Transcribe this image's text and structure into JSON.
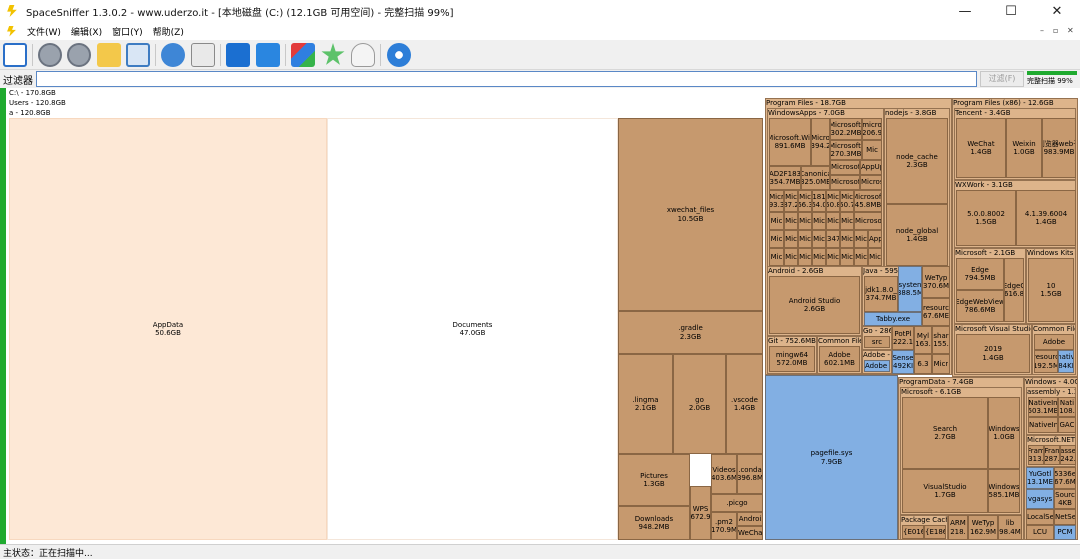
{
  "window": {
    "title": "SpaceSniffer 1.3.0.2 - www.uderzo.it - [本地磁盘 (C:) (12.1GB 可用空间) - 完整扫描 99%]",
    "minimize": "—",
    "maximize": "☐",
    "close": "✕"
  },
  "menu": {
    "items": [
      "文件(W)",
      "编辑(X)",
      "窗口(Y)",
      "帮助(Z)"
    ],
    "mdi": [
      "–",
      "▫",
      "✕"
    ]
  },
  "toolbar": {
    "icons": [
      "new-scan-icon",
      "back-icon",
      "forward-icon",
      "folder-up-icon",
      "home-icon",
      "refresh-icon",
      "export-icon",
      "blue-cube-icon",
      "blue-cube-2-icon",
      "blocks-icon",
      "star-icon",
      "ghost-icon",
      "settings-gear-icon"
    ]
  },
  "filter": {
    "label": "过滤器",
    "value": "",
    "button": "过滤(F)",
    "progress_text": "完整扫描 99%",
    "progress": 0.99
  },
  "treemap": {
    "root": "C:\\ - 170.8GB",
    "users": "Users - 120.8GB",
    "user_a": "a - 120.8GB",
    "appdata": {
      "name": "AppData",
      "size": "50.6GB"
    },
    "documents": {
      "name": "Documents",
      "size": "47.0GB"
    },
    "xwechat_files": {
      "name": "xwechat_files",
      "size": "10.5GB"
    },
    "gradle": {
      "name": ".gradle",
      "size": "2.3GB"
    },
    "lingma": {
      "name": ".lingma",
      "size": "2.1GB"
    },
    "go": {
      "name": "go",
      "size": "2.0GB"
    },
    "vscode": {
      "name": ".vscode",
      "size": "1.4GB"
    },
    "pictures": {
      "name": "Pictures",
      "size": "1.3GB"
    },
    "videos": {
      "name": "Videos",
      "size": "403.6M"
    },
    "conda": {
      "name": ".conda",
      "size": "396.8M"
    },
    "wps": {
      "name": "WPS",
      "size": "672.9"
    },
    "picgo": {
      "name": ".picgo",
      "size": ""
    },
    "downloads": {
      "name": "Downloads",
      "size": "948.2MB"
    },
    "pm2": {
      "name": ".pm2",
      "size": "170.9M"
    },
    "android_small": {
      "name": "Androi",
      "size": ""
    },
    "wechat_small": {
      "name": "WeCha",
      "size": ""
    },
    "program_files": "Program Files - 18.7GB",
    "windowsapps": "WindowsApps - 7.0GB",
    "ms_win": {
      "name": "Microsoft.Wir",
      "size": "891.6MB"
    },
    "ms_394": {
      "name": "Micro",
      "size": "394.2"
    },
    "ms_302": {
      "name": "Microsoft.",
      "size": "302.2MB"
    },
    "micro_206": {
      "name": "micro",
      "size": "206.9"
    },
    "ms_270": {
      "name": "Microsoft.",
      "size": "270.3MB"
    },
    "ad2f": {
      "name": "AD2F183",
      "size": "354.7MB"
    },
    "canonical": {
      "name": "Canonica",
      "size": "325.0MB"
    },
    "microsoft_s": "Microsoft",
    "appup": "AppUp",
    "micros": "Micros",
    "mic93": {
      "name": "Micr",
      "size": "93.3"
    },
    "mic87": {
      "name": "Mic",
      "size": "87.2"
    },
    "mic66": {
      "name": "Mic",
      "size": "66.3"
    },
    "m181": {
      "name": "181",
      "size": "64.0"
    },
    "mic50": {
      "name": "Mic",
      "size": "50.8"
    },
    "mic507": {
      "name": "Mic",
      "size": "50.7"
    },
    "ms45": {
      "name": "Microsoft",
      "size": "45.8MB"
    },
    "mic_grid": "Mic",
    "m347": "347",
    "app_s": "App",
    "nodejs": "nodejs - 3.8GB",
    "node_cache": {
      "name": "node_cache",
      "size": "2.3GB"
    },
    "node_global": {
      "name": "node_global",
      "size": "1.4GB"
    },
    "android_pf": "Android - 2.6GB",
    "android_studio": {
      "name": "Android Studio",
      "size": "2.6GB"
    },
    "java": "Java - 595",
    "jdk": {
      "name": "jdk1.8.0_",
      "size": "374.7MB"
    },
    "systen": {
      "name": "systen",
      "size": "388.5M"
    },
    "tabby": "Tabby.exe",
    "wetyp": {
      "name": "WeTyp",
      "size": "370.6M"
    },
    "resourc": {
      "name": "resourc",
      "size": "67.6ME"
    },
    "git": "Git - 752.6MB",
    "mingw": {
      "name": "mingw64",
      "size": "572.0MB"
    },
    "common_files": "Common File",
    "adobe_pf": {
      "name": "Adobe",
      "size": "602.1MB"
    },
    "go_pf": "Go - 286",
    "src": "src",
    "potpl": {
      "name": "PotPl",
      "size": "222.1"
    },
    "myl": {
      "name": "Myl",
      "size": "163."
    },
    "shar": {
      "name": "shar",
      "size": "155."
    },
    "adobe_dash": "Adobe -",
    "adobe_small": "Adobe (",
    "sense": {
      "name": "Sense",
      "size": "492KI"
    },
    "s63": "6.3",
    "micr_s": "Micr",
    "pagefile": {
      "name": "pagefile.sys",
      "size": "7.9GB"
    },
    "program_files_x86": "Program Files (x86) - 12.6GB",
    "tencent": "Tencent - 3.4GB",
    "wechat": {
      "name": "WeChat",
      "size": "1.4GB"
    },
    "weixin": {
      "name": "Weixin",
      "size": "1.0GB"
    },
    "qq_web": {
      "name": "浏览器web子",
      "size": "983.9MB"
    },
    "wxwork": "WXWork - 3.1GB",
    "v5": {
      "name": "5.0.0.8002",
      "size": "1.5GB"
    },
    "v41": {
      "name": "4.1.39.6004",
      "size": "1.4GB"
    },
    "microsoft_x86": "Microsoft - 2.1GB",
    "windows_kits": "Windows Kits -",
    "edge": {
      "name": "Edge",
      "size": "794.5MB"
    },
    "edgec": {
      "name": "EdgeC",
      "size": "616.8"
    },
    "edgewebview": {
      "name": "EdgeWebView",
      "size": "786.6MB"
    },
    "ten": {
      "name": "10",
      "size": "1.5GB"
    },
    "ms_visual_studio": "Microsoft Visual Studio -",
    "y2019": {
      "name": "2019",
      "size": "1.4GB"
    },
    "common_files_x86": "Common File",
    "adobe_x86": "Adobe",
    "resourc2": {
      "name": "resourc",
      "size": "192.5M"
    },
    "nativ": {
      "name": "nativ",
      "size": "84KI"
    },
    "program_data": "ProgramData - 7.4GB",
    "microsoft_pd": "Microsoft - 6.1GB",
    "search": {
      "name": "Search",
      "size": "2.7GB"
    },
    "windows_pd1": {
      "name": "Windows",
      "size": "1.0GB"
    },
    "visualstudio": {
      "name": "VisualStudio",
      "size": "1.7GB"
    },
    "windows_pd2": {
      "name": "Windows",
      "size": "585.1MB"
    },
    "package_cache": "Package Cache",
    "e016": "{E016",
    "e186": "{E186",
    "arm": {
      "name": "ARM",
      "size": "218."
    },
    "wetyp_pd": {
      "name": "WeTyp",
      "size": "162.9M"
    },
    "lib": {
      "name": "lib",
      "size": "98.4M"
    },
    "windows_root": "Windows - 4.0G",
    "assembly": "assembly - 1.3",
    "nativeim1": {
      "name": "NativeIn",
      "size": "503.1MB"
    },
    "nati": {
      "name": "Nati",
      "size": "108."
    },
    "nativeim2": "NativeIn",
    "gac": "GAC",
    "ms_net": "Microsoft.NET",
    "fram1": {
      "name": "Fram",
      "size": "313."
    },
    "fran": {
      "name": "Fran",
      "size": "287."
    },
    "asse": {
      "name": "asse",
      "size": "242."
    },
    "yugoti": {
      "name": "YuGotl",
      "size": "13.1ME"
    },
    "s5336": {
      "name": "5336e",
      "size": "67.6M"
    },
    "vgasys": "vgasys",
    "sourc": {
      "name": "Sourc",
      "size": "4KB"
    },
    "localse": "LocalSe",
    "netse": "NetSe",
    "lcu": "LCU",
    "pcm": "PCM"
  },
  "status": {
    "text": "主状态：正在扫描中..."
  }
}
